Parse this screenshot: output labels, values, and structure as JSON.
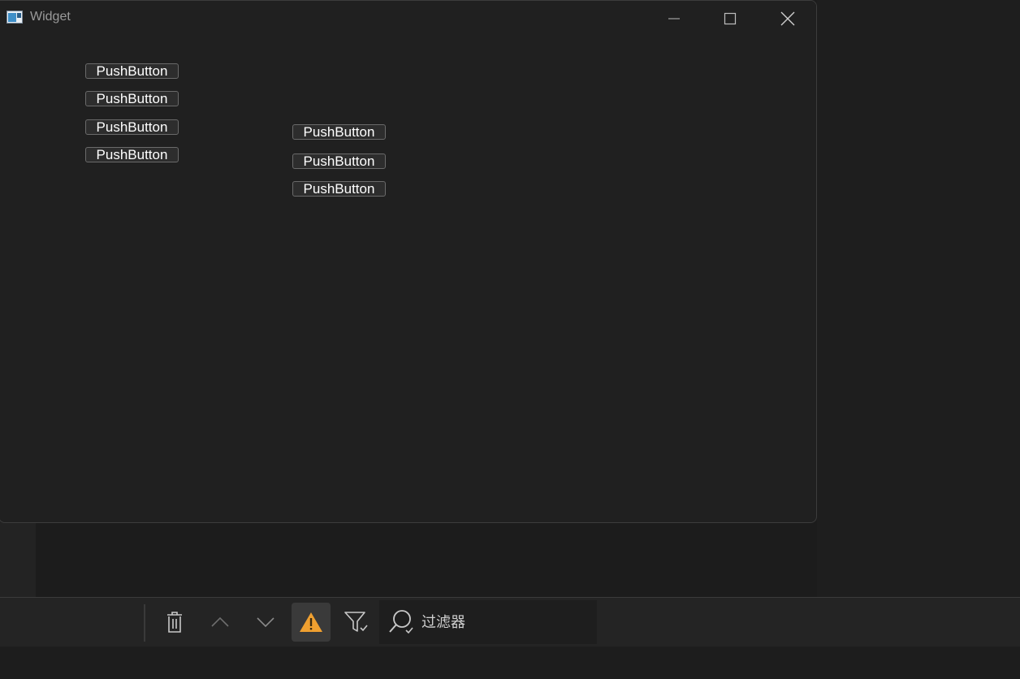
{
  "window": {
    "title": "Widget"
  },
  "buttons": {
    "column_left": [
      "PushButton",
      "PushButton",
      "PushButton",
      "PushButton"
    ],
    "column_right": [
      "PushButton",
      "PushButton",
      "PushButton"
    ]
  },
  "toolbar": {
    "filter_placeholder": "过滤器"
  },
  "colors": {
    "warning_accent": "#f0a030",
    "window_bg": "#202020",
    "button_bg": "#2d2d2d"
  },
  "icons": [
    "app-icon",
    "minimize-icon",
    "maximize-icon",
    "close-icon",
    "trash-icon",
    "chevron-up-icon",
    "chevron-down-icon",
    "warning-icon",
    "filter-icon",
    "search-icon"
  ]
}
